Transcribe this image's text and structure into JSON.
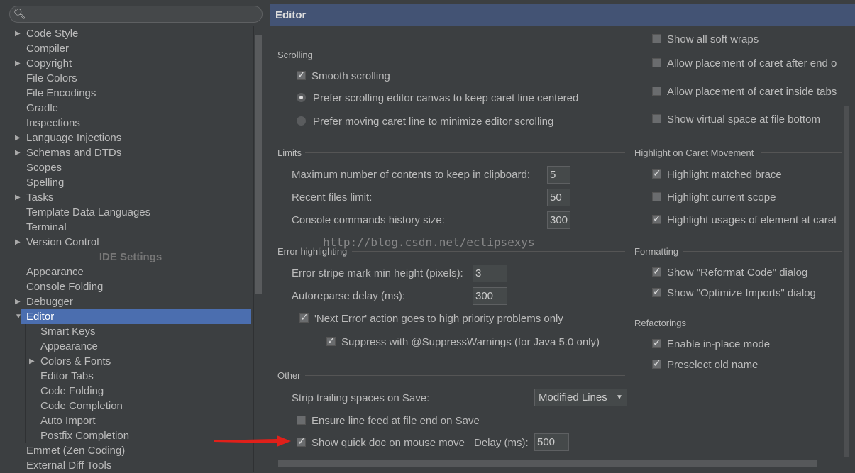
{
  "search": {
    "placeholder": "",
    "icon": "search-icon"
  },
  "tree": {
    "project_items": [
      {
        "label": "Code Style",
        "expandable": true
      },
      {
        "label": "Compiler"
      },
      {
        "label": "Copyright",
        "expandable": true
      },
      {
        "label": "File Colors"
      },
      {
        "label": "File Encodings"
      },
      {
        "label": "Gradle"
      },
      {
        "label": "Inspections"
      },
      {
        "label": "Language Injections",
        "expandable": true
      },
      {
        "label": "Schemas and DTDs",
        "expandable": true
      },
      {
        "label": "Scopes"
      },
      {
        "label": "Spelling"
      },
      {
        "label": "Tasks",
        "expandable": true
      },
      {
        "label": "Template Data Languages"
      },
      {
        "label": "Terminal"
      },
      {
        "label": "Version Control",
        "expandable": true
      }
    ],
    "ide_header": "IDE Settings",
    "ide_items": [
      {
        "label": "Appearance"
      },
      {
        "label": "Console Folding"
      },
      {
        "label": "Debugger",
        "expandable": true
      },
      {
        "label": "Editor",
        "expanded": true,
        "selected": true
      }
    ],
    "editor_children": [
      {
        "label": "Smart Keys"
      },
      {
        "label": "Appearance"
      },
      {
        "label": "Colors & Fonts",
        "expandable": true
      },
      {
        "label": "Editor Tabs"
      },
      {
        "label": "Code Folding"
      },
      {
        "label": "Code Completion"
      },
      {
        "label": "Auto Import"
      },
      {
        "label": "Postfix Completion"
      }
    ],
    "after_items": [
      {
        "label": "Emmet (Zen Coding)"
      },
      {
        "label": "External Diff Tools"
      }
    ]
  },
  "header": {
    "title": "Editor"
  },
  "scrolling": {
    "title": "Scrolling",
    "smooth": "Smooth scrolling",
    "radio1": "Prefer scrolling editor canvas to keep caret line centered",
    "radio2": "Prefer moving caret line to minimize editor scrolling"
  },
  "limits": {
    "title": "Limits",
    "clipboard_label": "Maximum number of contents to keep in clipboard:",
    "clipboard": "5",
    "recent_label": "Recent files limit:",
    "recent": "50",
    "console_label": "Console commands history size:",
    "console": "300"
  },
  "errors": {
    "title": "Error highlighting",
    "stripe_label": "Error stripe mark min height (pixels):",
    "stripe": "3",
    "autoreparse_label": "Autoreparse delay (ms):",
    "autoreparse": "300",
    "next_error": "'Next Error' action goes to high priority problems only",
    "suppress": "Suppress with @SuppressWarnings (for Java 5.0 only)"
  },
  "other": {
    "title": "Other",
    "strip_label": "Strip trailing spaces on Save:",
    "strip_value": "Modified Lines",
    "line_feed": "Ensure line feed at file end on Save",
    "quick_doc": "Show quick doc on mouse move",
    "delay_label": "Delay (ms):",
    "delay": "500"
  },
  "right": {
    "soft_wraps": "Show all soft wraps",
    "caret_end": "Allow placement of caret after end o",
    "caret_tabs": "Allow placement of caret inside tabs",
    "virtual_space": "Show virtual space at file bottom",
    "caret_title": "Highlight on Caret Movement",
    "matched_brace": "Highlight matched brace",
    "current_scope": "Highlight current scope",
    "usages": "Highlight usages of element at caret",
    "formatting_title": "Formatting",
    "reformat": "Show \"Reformat Code\" dialog",
    "optimize": "Show \"Optimize Imports\" dialog",
    "refactor_title": "Refactorings",
    "inplace": "Enable in-place mode",
    "preselect": "Preselect old name"
  },
  "watermark": "http://blog.csdn.net/eclipsexys",
  "colors": {
    "selection": "#4b6eaf",
    "header": "#435374",
    "arrow": "#e0201a"
  }
}
